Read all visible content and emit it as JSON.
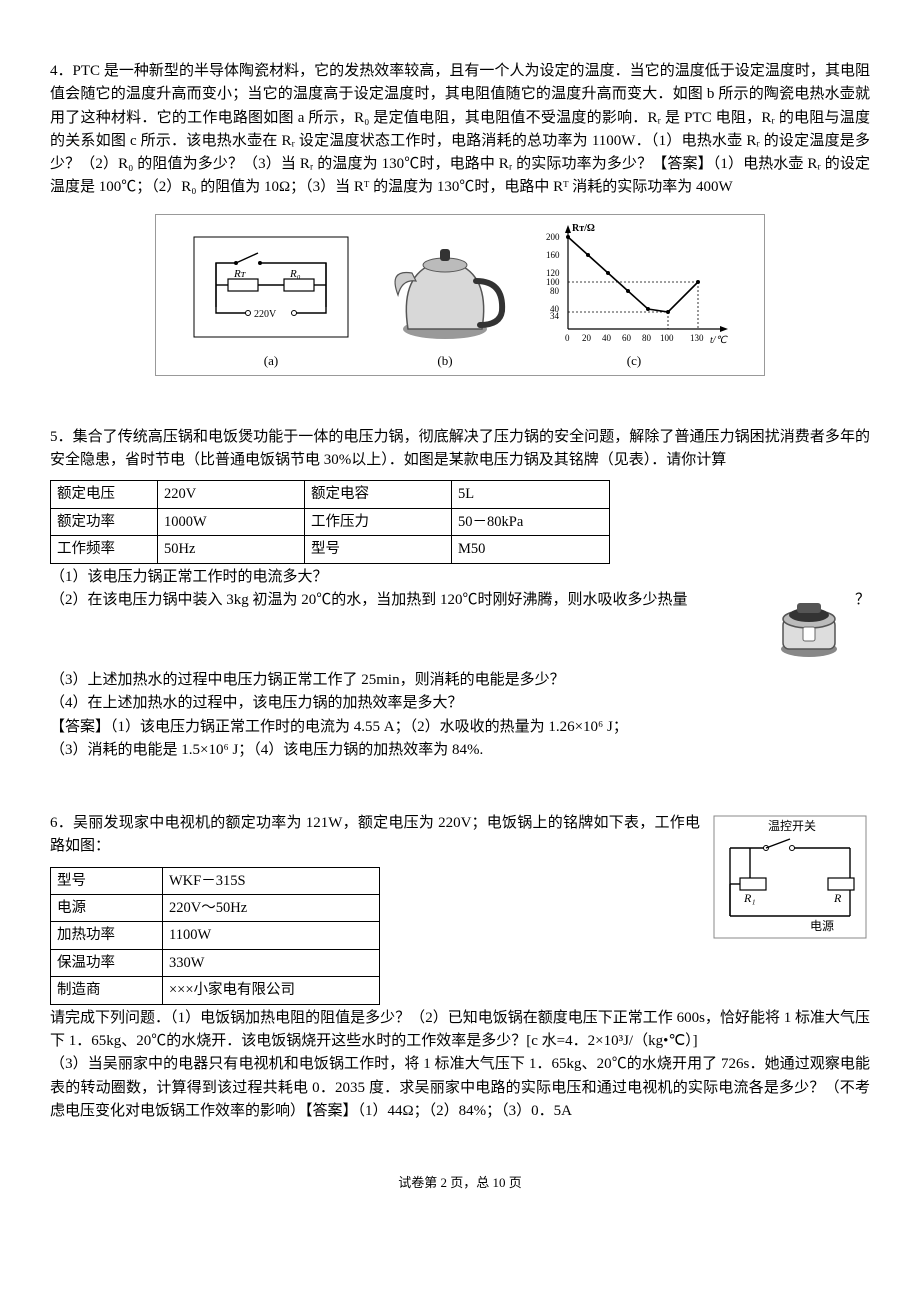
{
  "p4": {
    "text": "4．PTC 是一种新型的半导体陶瓷材料，它的发热效率较高，且有一个人为设定的温度．当它的温度低于设定温度时，其电阻值会随它的温度升高而变小；当它的温度高于设定温度时，其电阻值随它的温度升高而变大．如图 b 所示的陶瓷电热水壶就用了这种材料．它的工作电路图如图 a 所示，R₀ 是定值电阻，其电阻值不受温度的影响．Rᵣ 是 PTC 电阻，Rᵣ 的电阻与温度的关系如图 c 所示．该电热水壶在 Rᵣ 设定温度状态工作时，电路消耗的总功率为 1100W．（1）电热水壶 Rᵣ 的设定温度是多少？（2）R₀ 的阻值为多少？（3）当 Rᵣ 的温度为 130℃时，电路中 Rᵣ 的实际功率为多少？【答案】（1）电热水壶 Rᵣ 的设定温度是 100℃；（2）R₀ 的阻值为 10Ω；（3）当 Rᵀ 的温度为 130℃时，电路中 Rᵀ 消耗的实际功率为 400W",
    "fig_a": "(a)",
    "fig_b": "(b)",
    "fig_c": "(c)",
    "circuit": {
      "rt": "Rᴛ",
      "r0": "R₀",
      "v": "220V"
    },
    "chart_y_label": "Rᴛ/Ω",
    "chart_x_label": "t/℃",
    "chart_y_ticks": [
      "200",
      "160",
      "120",
      "100",
      "80",
      "40",
      "34"
    ],
    "chart_x_ticks": [
      "0",
      "20",
      "40",
      "60",
      "80",
      "100",
      "130"
    ]
  },
  "p5": {
    "intro": "5．集合了传统高压锅和电饭煲功能于一体的电压力锅，彻底解决了压力锅的安全问题，解除了普通压力锅困扰消费者多年的安全隐患，省时节电（比普通电饭锅节电 30%以上）．如图是某款电压力锅及其铭牌（见表）．请你计算",
    "table": [
      [
        "额定电压",
        "220V",
        "额定电容",
        "5L"
      ],
      [
        "额定功率",
        "1000W",
        "工作压力",
        "50－80kPa"
      ],
      [
        "工作频率",
        "50Hz",
        "型号",
        "M50"
      ]
    ],
    "q1": "（1）该电压力锅正常工作时的电流多大？",
    "q2a": "（2）在该电压力锅中装入 3kg 初温为 20℃的水，当加热到 120℃时刚好沸腾，则水吸收多少热量",
    "q2b": "？",
    "q3": "（3）上述加热水的过程中电压力锅正常工作了 25min，则消耗的电能是多少？",
    "q4": "（4）在上述加热水的过程中，该电压力锅的加热效率是多大？",
    "a1": "【答案】（1）该电压力锅正常工作时的电流为 4.55 A；（2）水吸收的热量为 1.26×10⁶ J；",
    "a2": "（3）消耗的电能是 1.5×10⁶ J；（4）该电压力锅的加热效率为 84%."
  },
  "p6": {
    "intro": "6．吴丽发现家中电视机的额定功率为 121W，额定电压为 220V；电饭锅上的铭牌如下表，工作电路如图：",
    "circuit": {
      "sw": "温控开关",
      "r1": "R₁",
      "r": "R",
      "src": "电源"
    },
    "table": [
      [
        "型号",
        "WKF－315S"
      ],
      [
        "电源",
        "220V～50Hᴢ"
      ],
      [
        "加热功率",
        "1100W"
      ],
      [
        "保温功率",
        "330W"
      ],
      [
        "制造商",
        "×××小家电有限公司"
      ]
    ],
    "rest": "请完成下列问题．（1）电饭锅加热电阻的阻值是多少？（2）已知电饭锅在额度电压下正常工作 600s，恰好能将 1 标准大气压下 1．65kg、20℃的水烧开．该电饭锅烧开这些水时的工作效率是多少？[c 水=4．2×10³J/（kg•℃）]\n（3）当吴丽家中的电器只有电视机和电饭锅工作时，将 1 标准大气压下 1．65kg、20℃的水烧开用了 726s．她通过观察电能表的转动圈数，计算得到该过程共耗电 0．2035 度．求吴丽家中电路的实际电压和通过电视机的实际电流各是多少？（不考虑电压变化对电饭锅工作效率的影响）【答案】（1）44Ω；（2）84%；（3）0．5A"
  },
  "footer": "试卷第 2 页，总 10 页",
  "chart_data": {
    "type": "line",
    "title": "Rᴛ vs t",
    "xlabel": "t/℃",
    "ylabel": "Rᴛ/Ω",
    "x": [
      0,
      20,
      40,
      60,
      80,
      100,
      130
    ],
    "y": [
      200,
      160,
      120,
      80,
      40,
      34,
      100
    ],
    "xlim": [
      0,
      140
    ],
    "ylim": [
      0,
      200
    ]
  }
}
